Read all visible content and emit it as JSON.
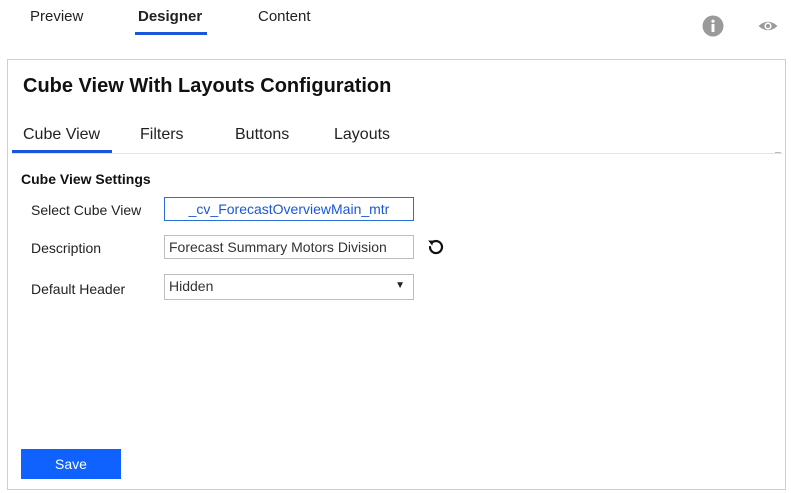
{
  "top_tabs": {
    "preview": "Preview",
    "designer": "Designer",
    "content": "Content"
  },
  "icons": {
    "info": "info-icon",
    "preview": "eye-icon",
    "reset": "reset-icon",
    "dropdown": "chevron-down-icon"
  },
  "panel": {
    "title": "Cube View With Layouts Configuration",
    "tabs": [
      {
        "label": "Cube View"
      },
      {
        "label": "Filters"
      },
      {
        "label": "Buttons"
      },
      {
        "label": "Layouts"
      }
    ],
    "section_title": "Cube View Settings",
    "fields": {
      "select_cube_view": {
        "label": "Select Cube View",
        "value": "_cv_ForecastOverviewMain_mtr"
      },
      "description": {
        "label": "Description",
        "value": "Forecast Summary Motors Division"
      },
      "default_header": {
        "label": "Default Header",
        "value": "Hidden"
      }
    },
    "save_label": "Save"
  },
  "colors": {
    "accent": "#1a56db",
    "save_button": "#0f62fe",
    "icon_gray": "#9a9a9a"
  }
}
